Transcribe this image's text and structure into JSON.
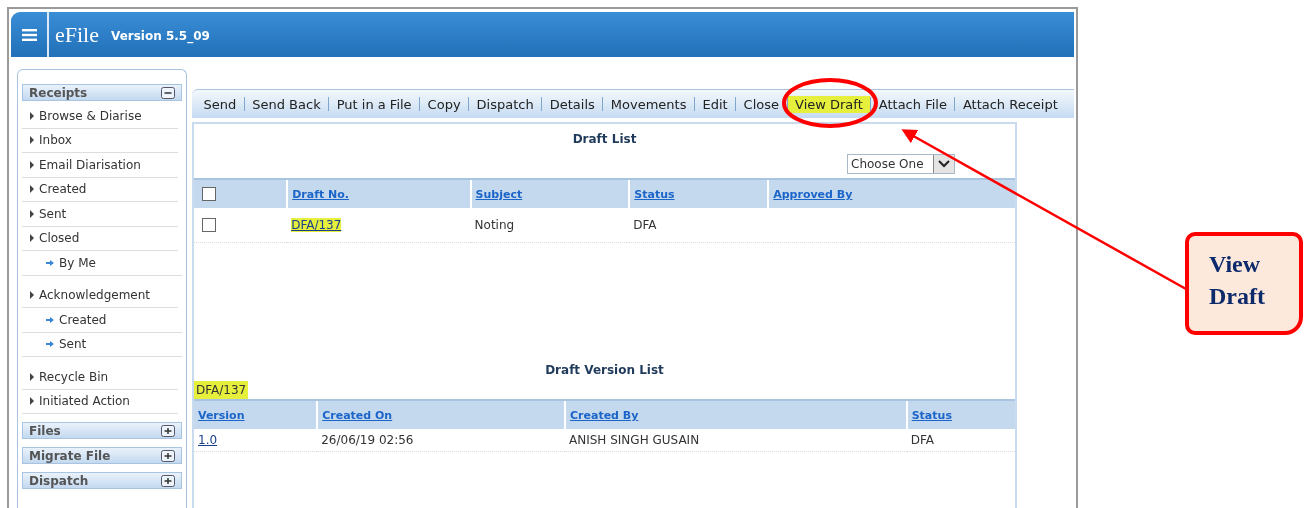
{
  "app": {
    "title": "eFile",
    "version": "Version 5.5_09"
  },
  "sidebar": {
    "sections": [
      {
        "title": "Receipts",
        "expanded": true,
        "items": [
          {
            "label": "Browse & Diarise"
          },
          {
            "label": "Inbox"
          },
          {
            "label": "Email Diarisation"
          },
          {
            "label": "Created"
          },
          {
            "label": "Sent"
          },
          {
            "label": "Closed",
            "children": [
              {
                "label": "By Me"
              }
            ]
          },
          {
            "label": "Acknowledgement",
            "children": [
              {
                "label": "Created"
              },
              {
                "label": "Sent"
              }
            ]
          },
          {
            "label": "Recycle Bin"
          },
          {
            "label": "Initiated Action"
          }
        ]
      },
      {
        "title": "Files",
        "expanded": false
      },
      {
        "title": "Migrate File",
        "expanded": false
      },
      {
        "title": "Dispatch",
        "expanded": false
      }
    ]
  },
  "toolbar": {
    "actions": [
      {
        "label": "Send",
        "highlighted": false
      },
      {
        "label": "Send Back",
        "highlighted": false
      },
      {
        "label": "Put in a File",
        "highlighted": false
      },
      {
        "label": "Copy",
        "highlighted": false
      },
      {
        "label": "Dispatch",
        "highlighted": false
      },
      {
        "label": "Details",
        "highlighted": false
      },
      {
        "label": "Movements",
        "highlighted": false
      },
      {
        "label": "Edit",
        "highlighted": false
      },
      {
        "label": "Close",
        "highlighted": false
      },
      {
        "label": "View Draft",
        "highlighted": true
      },
      {
        "label": "Attach File",
        "highlighted": false
      },
      {
        "label": "Attach Receipt",
        "highlighted": false
      }
    ]
  },
  "draft_list": {
    "title": "Draft List",
    "dropdown": {
      "value": "Choose One"
    },
    "select_all": {
      "checked": false
    },
    "columns": [
      "Draft No.",
      "Subject",
      "Status",
      "Approved By"
    ],
    "rows": [
      {
        "checked": false,
        "draft_no": "DFA/137",
        "highlighted": true,
        "subject": "Noting",
        "status": "DFA"
      }
    ]
  },
  "version_list": {
    "title": "Draft Version List",
    "draft": {
      "text": "DFA/137",
      "highlighted": true
    },
    "columns": [
      "Version",
      "Created On",
      "Created By",
      "Status"
    ],
    "rows": [
      {
        "version": "1.0",
        "created_on": "26/06/19 02:56",
        "created_by": "ANISH SINGH GUSAIN",
        "status": "DFA"
      }
    ]
  },
  "annotation": {
    "callout": "View Draft"
  }
}
